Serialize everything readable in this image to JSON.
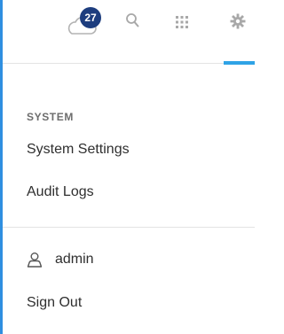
{
  "header": {
    "notification_count": "27",
    "icons": [
      "cloud-icon",
      "search-icon",
      "apps-grid-icon",
      "gear-icon"
    ],
    "accent_color": "#2fa3e6",
    "badge_color": "#1d3d7e"
  },
  "menu": {
    "section_label": "SYSTEM",
    "system_settings_label": "System Settings",
    "audit_logs_label": "Audit Logs"
  },
  "user": {
    "icon": "user-icon",
    "name": "admin",
    "sign_out_label": "Sign Out"
  }
}
